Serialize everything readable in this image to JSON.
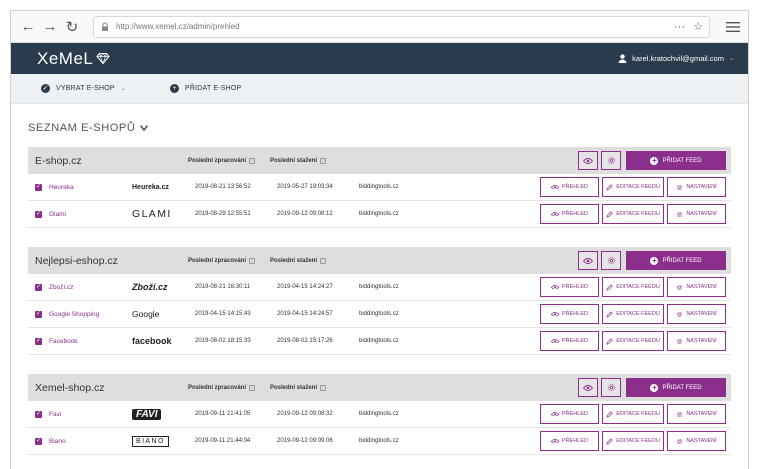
{
  "browser": {
    "url": "http://www.xemel.cz/admin/prehled",
    "dots": "···"
  },
  "app": {
    "logo": "XeMeL",
    "user_email": "karel.kratochvil@gmail.com"
  },
  "subnav": {
    "select_label": "VYBRAT E-SHOP",
    "add_label": "PŘIDAT E-SHOP"
  },
  "page": {
    "title": "SEZNAM E-SHOPŮ"
  },
  "labels": {
    "col_processed": "Poslední zpracování",
    "col_downloaded": "Poslední stažení",
    "add_feed": "PŘIDAT FEED",
    "overview": "PŘEHLED",
    "edit_feed": "EDITACE FEEDU",
    "settings": "NASTAVENÍ"
  },
  "colors": {
    "accent": "#8c2e8c",
    "header": "#2b3b4e"
  },
  "shops": [
    {
      "name": "E-shop.cz",
      "feeds": [
        {
          "name": "Heureka",
          "logo": "Heureka.cz",
          "processed": "2019-08-21 13:56:52",
          "downloaded": "2019-05-27 19:03:34",
          "source": "biddingtools.cz"
        },
        {
          "name": "Glami",
          "logo": "GLAMI",
          "processed": "2019-08-29 12:55:51",
          "downloaded": "2019-09-12 09:08:12",
          "source": "biddingtools.cz"
        }
      ]
    },
    {
      "name": "Nejlepsi-eshop.cz",
      "feeds": [
        {
          "name": "Zboží.cz",
          "logo": "Zboží.cz",
          "processed": "2019-08-21 16:30:11",
          "downloaded": "2019-04-15 14:24:27",
          "source": "biddingtools.cz"
        },
        {
          "name": "Google Shopping",
          "logo": "Google",
          "processed": "2019-04-15 14:15:43",
          "downloaded": "2019-04-15 14:24:57",
          "source": "biddingtools.cz"
        },
        {
          "name": "Facebook",
          "logo": "facebook",
          "processed": "2019-08-02 18:15:33",
          "downloaded": "2019-08-02 15:17:26",
          "source": "biddingtools.cz"
        }
      ]
    },
    {
      "name": "Xemel-shop.cz",
      "feeds": [
        {
          "name": "Favi",
          "logo": "FAVI",
          "processed": "2019-09-11 21:41:05",
          "downloaded": "2019-09-12 09:08:32",
          "source": "biddingtools.cz"
        },
        {
          "name": "Biano",
          "logo": "BIANO",
          "processed": "2019-09-11 21:44:04",
          "downloaded": "2019-09-12 09:09:06",
          "source": "biddingtools.cz"
        }
      ]
    }
  ]
}
